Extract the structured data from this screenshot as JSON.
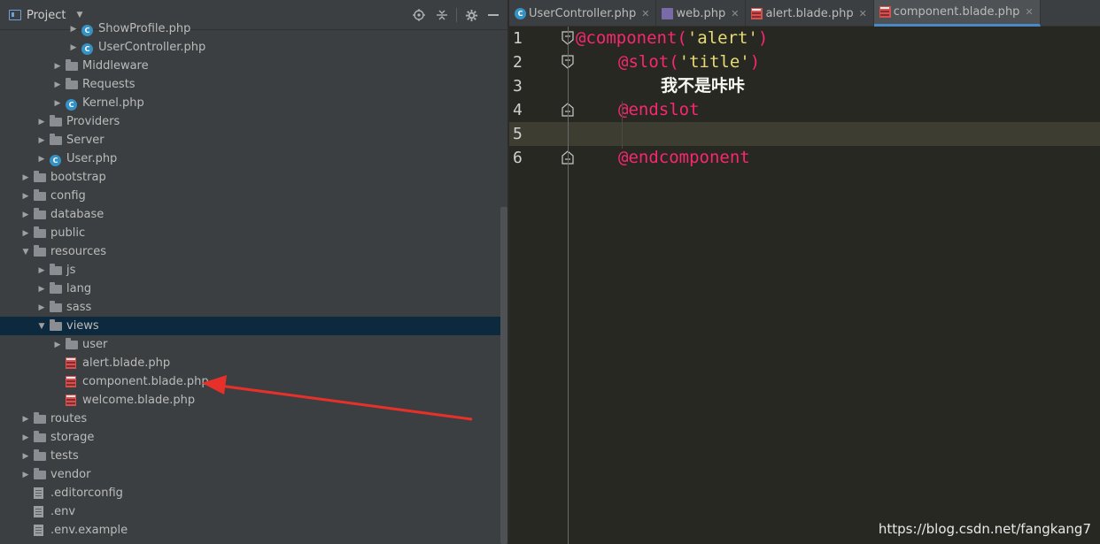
{
  "project_panel": {
    "title": "Project",
    "toolbar_icons": [
      "locate-icon",
      "collapse-icon",
      "settings-icon",
      "hide-icon"
    ],
    "tree": [
      {
        "label": "ShowProfile.php",
        "icon": "class",
        "arrow": true,
        "depth": 4,
        "expanded": false
      },
      {
        "label": "UserController.php",
        "icon": "class",
        "arrow": true,
        "depth": 4,
        "expanded": false
      },
      {
        "label": "Middleware",
        "icon": "folder",
        "arrow": true,
        "depth": 3,
        "expanded": false
      },
      {
        "label": "Requests",
        "icon": "folder",
        "arrow": true,
        "depth": 3,
        "expanded": false
      },
      {
        "label": "Kernel.php",
        "icon": "class",
        "arrow": true,
        "depth": 3,
        "expanded": false
      },
      {
        "label": "Providers",
        "icon": "folder",
        "arrow": true,
        "depth": 2,
        "expanded": false
      },
      {
        "label": "Server",
        "icon": "folder",
        "arrow": true,
        "depth": 2,
        "expanded": false
      },
      {
        "label": "User.php",
        "icon": "class",
        "arrow": true,
        "depth": 2,
        "expanded": false
      },
      {
        "label": "bootstrap",
        "icon": "folder",
        "arrow": true,
        "depth": 1,
        "expanded": false
      },
      {
        "label": "config",
        "icon": "folder",
        "arrow": true,
        "depth": 1,
        "expanded": false
      },
      {
        "label": "database",
        "icon": "folder",
        "arrow": true,
        "depth": 1,
        "expanded": false
      },
      {
        "label": "public",
        "icon": "folder",
        "arrow": true,
        "depth": 1,
        "expanded": false
      },
      {
        "label": "resources",
        "icon": "folder",
        "arrow": true,
        "depth": 1,
        "expanded": true
      },
      {
        "label": "js",
        "icon": "folder",
        "arrow": true,
        "depth": 2,
        "expanded": false
      },
      {
        "label": "lang",
        "icon": "folder",
        "arrow": true,
        "depth": 2,
        "expanded": false
      },
      {
        "label": "sass",
        "icon": "folder",
        "arrow": true,
        "depth": 2,
        "expanded": false
      },
      {
        "label": "views",
        "icon": "folder",
        "arrow": true,
        "depth": 2,
        "expanded": true,
        "selected": true
      },
      {
        "label": "user",
        "icon": "folder",
        "arrow": true,
        "depth": 3,
        "expanded": false
      },
      {
        "label": "alert.blade.php",
        "icon": "blade",
        "arrow": false,
        "depth": 3
      },
      {
        "label": "component.blade.php",
        "icon": "blade",
        "arrow": false,
        "depth": 3
      },
      {
        "label": "welcome.blade.php",
        "icon": "blade",
        "arrow": false,
        "depth": 3
      },
      {
        "label": "routes",
        "icon": "folder",
        "arrow": true,
        "depth": 1,
        "expanded": false
      },
      {
        "label": "storage",
        "icon": "folder",
        "arrow": true,
        "depth": 1,
        "expanded": false
      },
      {
        "label": "tests",
        "icon": "folder",
        "arrow": true,
        "depth": 1,
        "expanded": false
      },
      {
        "label": "vendor",
        "icon": "folder",
        "arrow": true,
        "depth": 1,
        "expanded": false
      },
      {
        "label": ".editorconfig",
        "icon": "file",
        "arrow": false,
        "depth": 1
      },
      {
        "label": ".env",
        "icon": "file",
        "arrow": false,
        "depth": 1
      },
      {
        "label": ".env.example",
        "icon": "file",
        "arrow": false,
        "depth": 1
      }
    ]
  },
  "editor": {
    "tabs": [
      {
        "label": "UserController.php",
        "icon": "class",
        "active": false
      },
      {
        "label": "web.php",
        "icon": "php",
        "active": false
      },
      {
        "label": "alert.blade.php",
        "icon": "blade",
        "active": false
      },
      {
        "label": "component.blade.php",
        "icon": "blade",
        "active": true
      }
    ],
    "lines": [
      {
        "num": "1",
        "tokens": [
          {
            "t": "@component",
            "c": "kw"
          },
          {
            "t": "(",
            "c": "paren"
          },
          {
            "t": "'alert'",
            "c": "str"
          },
          {
            "t": ")",
            "c": "paren"
          }
        ],
        "indent": 0
      },
      {
        "num": "2",
        "tokens": [
          {
            "t": "@slot",
            "c": "kw"
          },
          {
            "t": "(",
            "c": "paren"
          },
          {
            "t": "'title'",
            "c": "str"
          },
          {
            "t": ")",
            "c": "paren"
          }
        ],
        "indent": 1
      },
      {
        "num": "3",
        "tokens": [
          {
            "t": "我不是咔咔",
            "c": "txt"
          }
        ],
        "indent": 2
      },
      {
        "num": "4",
        "tokens": [
          {
            "t": "@endslot",
            "c": "kw"
          }
        ],
        "indent": 1
      },
      {
        "num": "5",
        "tokens": [],
        "indent": 0,
        "current": true
      },
      {
        "num": "6",
        "tokens": [
          {
            "t": "@endcomponent",
            "c": "kw"
          }
        ],
        "indent": 1
      }
    ]
  },
  "watermark": "https://blog.csdn.net/fangkang7",
  "colors": {
    "keyword": "#f92672",
    "string": "#e6db74",
    "annotation_arrow": "#e8302a"
  }
}
